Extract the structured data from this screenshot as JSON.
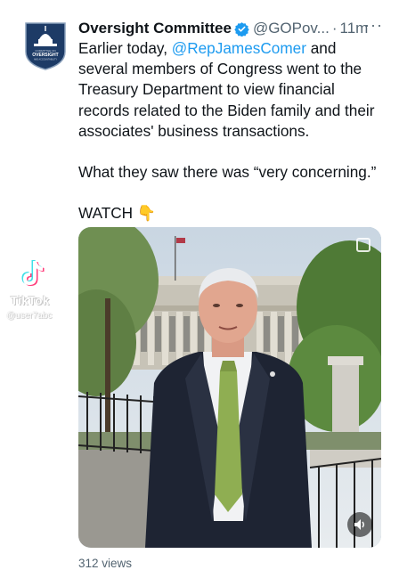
{
  "tweet": {
    "author_name": "Oversight Committee",
    "handle": "@GOPov...",
    "separator": "·",
    "time": "11m",
    "more": "···",
    "avatar_text_top": "COMMITTEE ON",
    "avatar_text_main": "OVERSIGHT",
    "avatar_text_bottom": "AND ACCOUNTABILITY",
    "text_before_mention": "Earlier today, ",
    "mention": "@RepJamesComer",
    "text_after_mention": " and several members of Congress went to the Treasury Department to view financial records related to the Biden family and their associates' business transactions.",
    "quote_line": "What they saw there was “very concerning.”",
    "watch_label": "WATCH",
    "watch_emoji": "👇",
    "views": "312 views"
  },
  "watermark": {
    "brand": "TikTok",
    "username": "@user7abc"
  },
  "colors": {
    "link": "#1d9bf0",
    "verified": "#1d9bf0",
    "muted": "#536471",
    "text": "#0f1419"
  },
  "icons": {
    "verified": "verified-badge-icon",
    "more": "more-icon",
    "sound": "speaker-icon",
    "expand": "expand-icon",
    "tiktok": "tiktok-logo-icon"
  }
}
